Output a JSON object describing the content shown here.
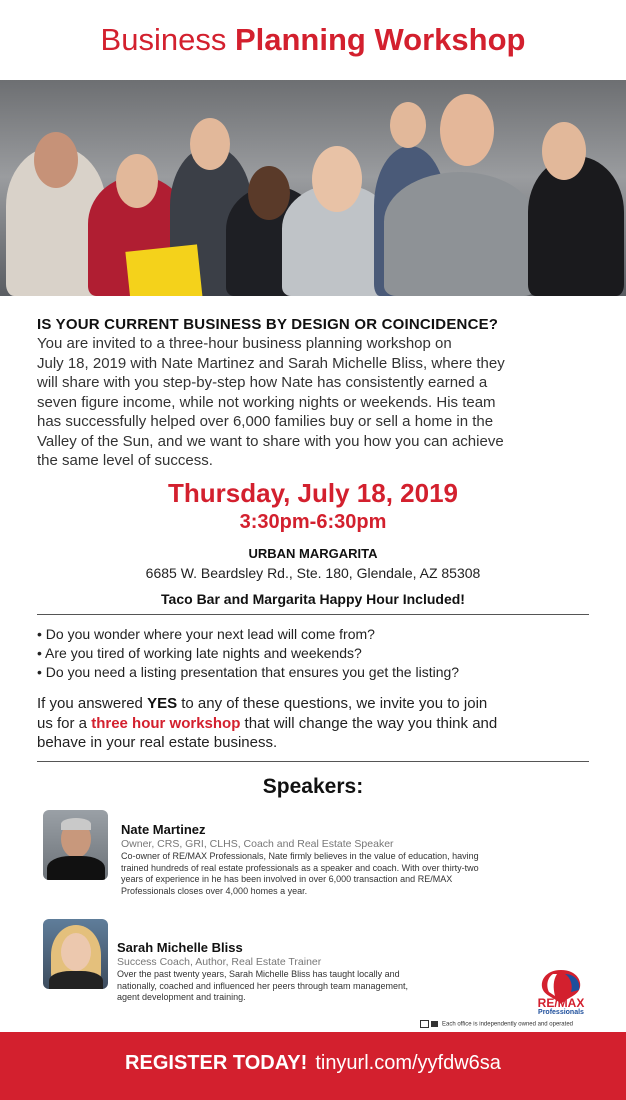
{
  "title": {
    "part1": "Business",
    "part2": "Planning Workshop"
  },
  "headline": "IS YOUR CURRENT BUSINESS BY DESIGN OR COINCIDENCE?",
  "intro_lines": [
    "You are invited to a three-hour business planning workshop on",
    "July 18, 2019 with Nate Martinez and Sarah Michelle Bliss, where they",
    "will share with you step-by-step how Nate has consistently earned a",
    "seven figure income, while not working nights or weekends. His team",
    "has successfully helped over 6,000 families buy or sell a home in the",
    "Valley of the Sun, and we want to share with you how you can achieve",
    "the same level of success."
  ],
  "event": {
    "date": "Thursday, July 18, 2019",
    "time": "3:30pm-6:30pm",
    "venue": "URBAN MARGARITA",
    "address": "6685 W. Beardsley Rd., Ste. 180, Glendale, AZ 85308",
    "perk": "Taco Bar and Margarita Happy Hour Included!"
  },
  "questions": [
    "Do you wonder where your next lead will come from?",
    "Are you tired of working late nights and weekends?",
    "Do you need a listing presentation that ensures you get the listing?"
  ],
  "invite": {
    "p1": "If you answered ",
    "yes": "YES",
    "p2": " to any of these questions, we invite you to join",
    "p3": "us for a ",
    "workshop": "three hour workshop",
    "p4": " that will change the way you think and",
    "p5": "behave in your real estate business."
  },
  "speakers_heading": "Speakers:",
  "speakers": [
    {
      "name": "Nate Martinez",
      "role": "Owner, CRS, GRI, CLHS, Coach and Real Estate Speaker",
      "bio_lines": [
        "Co-owner of RE/MAX Professionals, Nate firmly believes in the value of education, having",
        "trained hundreds of real estate professionals as a speaker and coach. With over thirty-two",
        "years of experience in he has been involved in over 6,000 transaction and RE/MAX",
        "Professionals closes over 4,000 homes a year."
      ]
    },
    {
      "name": "Sarah Michelle Bliss",
      "role": "Success Coach, Author, Real Estate Trainer",
      "bio_lines": [
        "Over the past twenty years, Sarah Michelle Bliss has taught locally and",
        "nationally, coached and influenced her peers through team management,",
        " agent development and training."
      ]
    }
  ],
  "logo": {
    "brand": "RE/MAX",
    "sub": "Professionals"
  },
  "disclaimer": "Each office is independently owned and operated",
  "footer": {
    "cta": "REGISTER TODAY!",
    "url": "tinyurl.com/yyfdw6sa"
  },
  "colors": {
    "accent": "#d3202e"
  }
}
